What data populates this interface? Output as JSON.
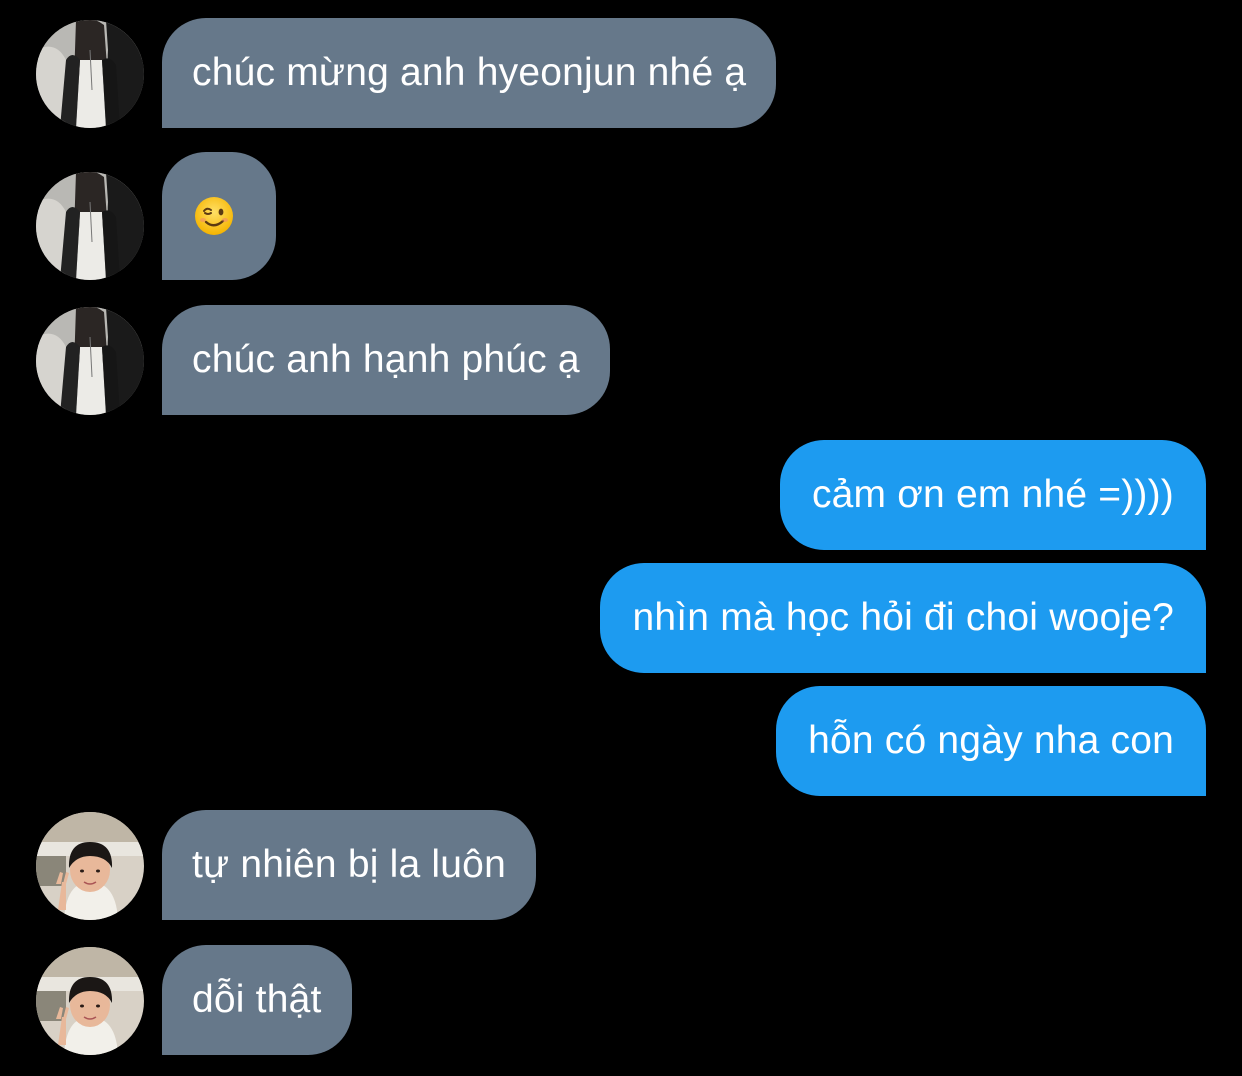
{
  "conversation": {
    "messages": [
      {
        "sender": "other_a",
        "avatar": "avatar-woman-icon",
        "text": "chúc mừng anh hyeonjun nhé ạ"
      },
      {
        "sender": "other_a",
        "avatar": "avatar-woman-icon",
        "emoji": "winking-face-emoji"
      },
      {
        "sender": "other_a",
        "avatar": "avatar-woman-icon",
        "text": "chúc anh hạnh phúc ạ"
      },
      {
        "sender": "me",
        "text": "cảm ơn em nhé =))))"
      },
      {
        "sender": "me",
        "text": "nhìn mà học hỏi đi choi wooje?"
      },
      {
        "sender": "me",
        "text": "hỗn có ngày nha con"
      },
      {
        "sender": "other_b",
        "avatar": "avatar-child-icon",
        "text": "tự nhiên bị la luôn"
      },
      {
        "sender": "other_b",
        "avatar": "avatar-child-icon",
        "text": "dỗi thật"
      }
    ]
  },
  "colors": {
    "background": "#000000",
    "incoming_bubble": "#66788a",
    "outgoing_bubble": "#1d9bf0",
    "text": "#ffffff"
  }
}
